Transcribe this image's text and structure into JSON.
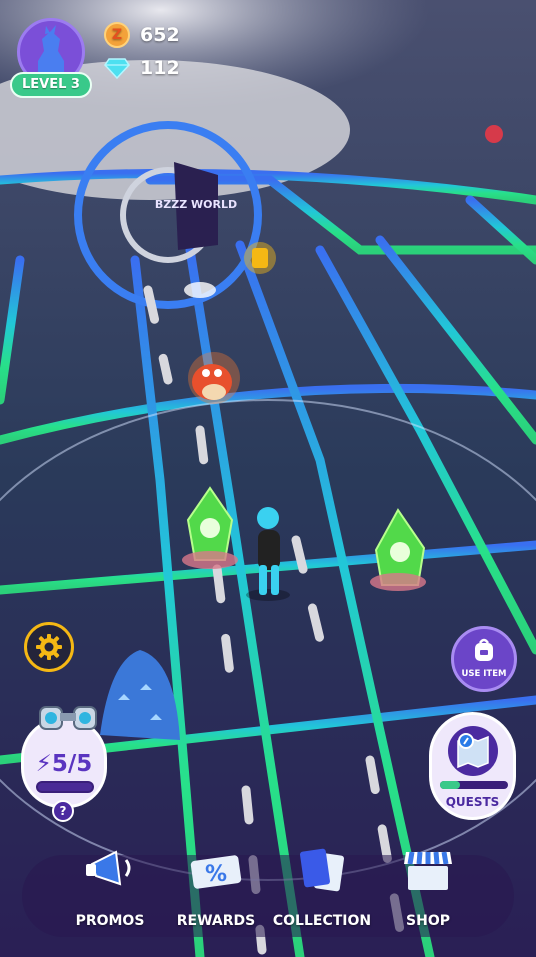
{
  "player": {
    "level_label": "LEVEL 3"
  },
  "currencies": {
    "coins": "652",
    "gems": "112",
    "coin_symbol": "Z"
  },
  "landmark": {
    "banner_text": "BZZZ WORLD"
  },
  "energy": {
    "label": "5/5",
    "current": 5,
    "max": 5,
    "help_symbol": "?"
  },
  "actions": {
    "use_item_label": "USE ITEM",
    "quests_label": "QUESTS"
  },
  "nav": [
    {
      "label": "PROMOS",
      "icon": "megaphone-icon"
    },
    {
      "label": "REWARDS",
      "icon": "percent-ticket-icon"
    },
    {
      "label": "COLLECTION",
      "icon": "cards-icon"
    },
    {
      "label": "SHOP",
      "icon": "shop-awning-icon"
    }
  ],
  "colors": {
    "accent_purple": "#6b45c8",
    "road_green": "#23d07a",
    "road_blue": "#2f7cf0",
    "gear_yellow": "#f5b814"
  }
}
